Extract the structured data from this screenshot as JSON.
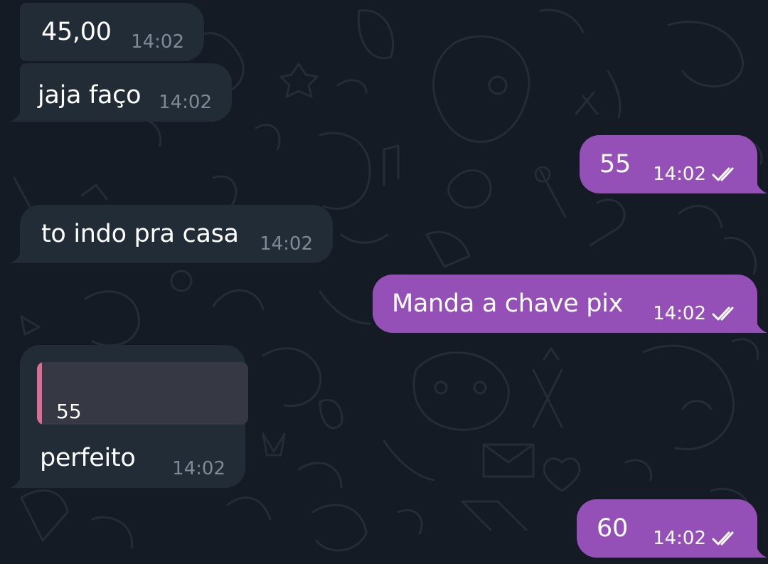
{
  "chat": {
    "messages": [
      {
        "direction": "incoming",
        "text": "45,00",
        "time": "14:02"
      },
      {
        "direction": "incoming",
        "text": "jaja faço",
        "time": "14:02"
      },
      {
        "direction": "outgoing",
        "text": "55",
        "time": "14:02",
        "status_icon": "double-check-icon"
      },
      {
        "direction": "incoming",
        "text": "to indo pra casa",
        "time": "14:02"
      },
      {
        "direction": "outgoing",
        "text": "Manda a chave pix",
        "time": "14:02",
        "status_icon": "double-check-icon"
      },
      {
        "direction": "incoming",
        "reply_to": "55",
        "text": "perfeito",
        "time": "14:02"
      },
      {
        "direction": "outgoing",
        "text": "60",
        "time": "14:02",
        "status_icon": "double-check-icon"
      }
    ]
  },
  "colors": {
    "background": "#151b24",
    "incoming_bubble": "#222c36",
    "outgoing_bubble": "#9550b8",
    "reply_accent": "#d76f93"
  }
}
